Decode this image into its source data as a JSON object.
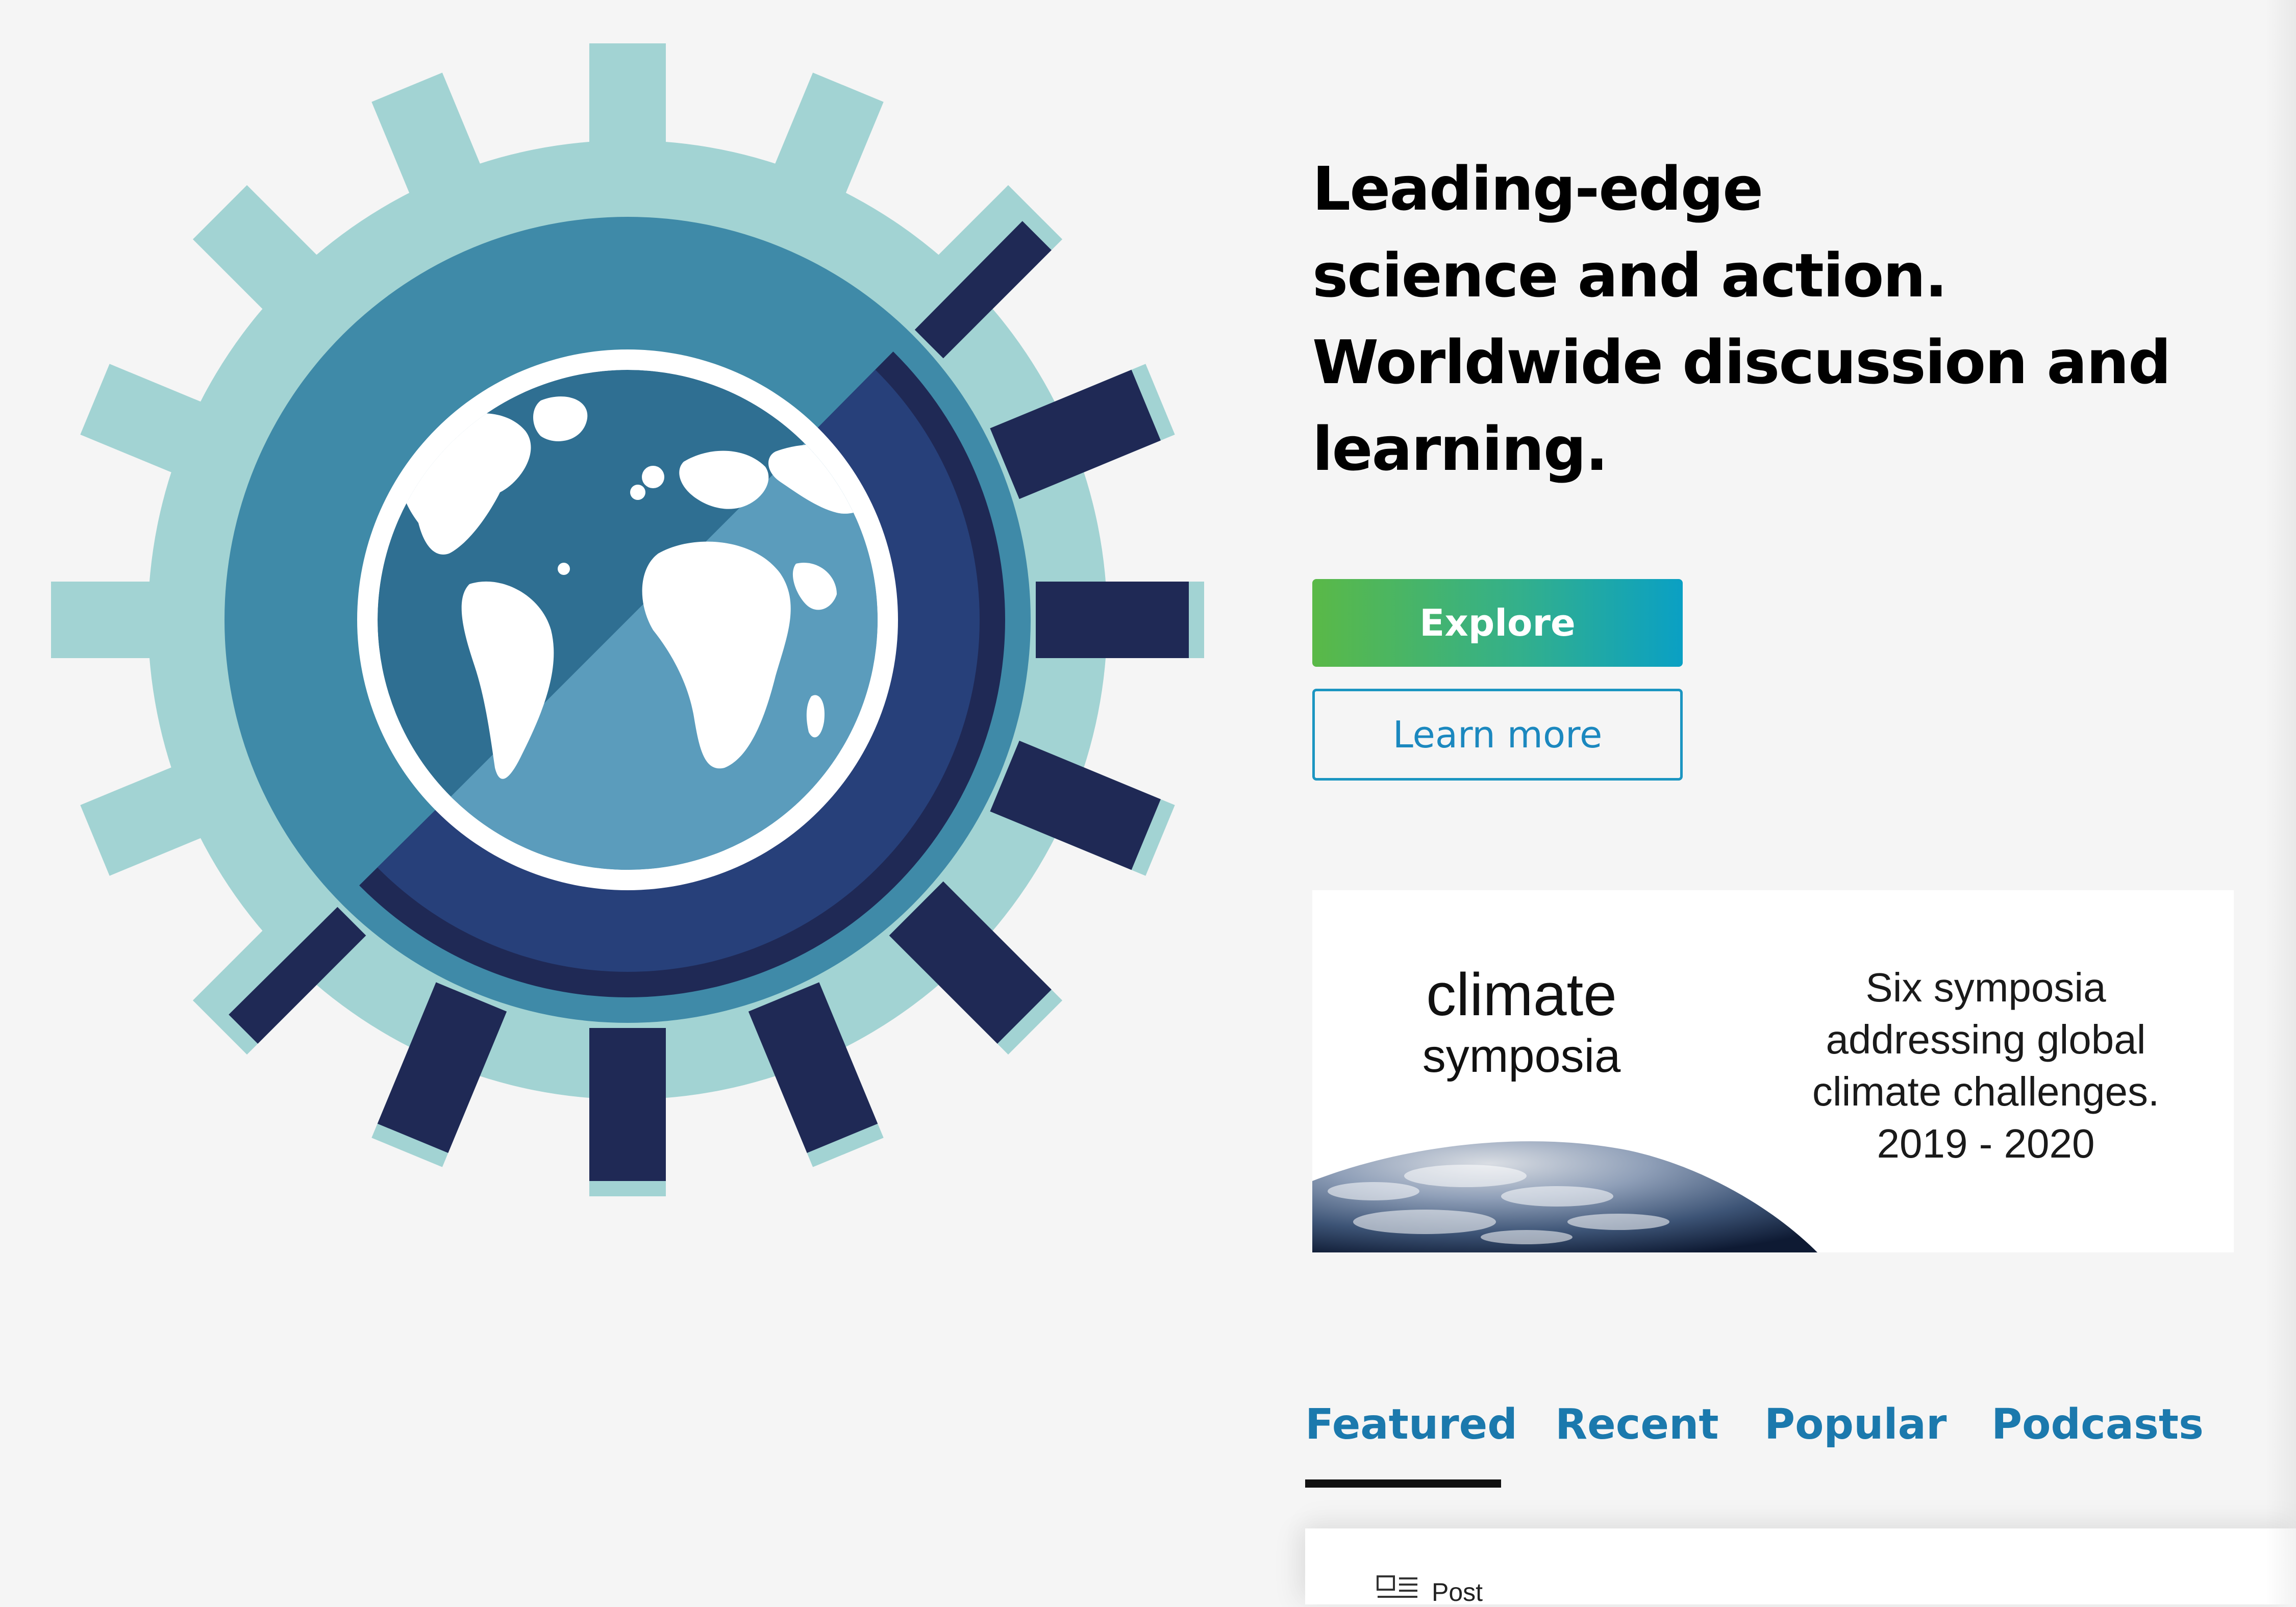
{
  "hero": {
    "headline_lines": [
      "Leading-edge",
      "science and action.",
      "Worldwide discussion and",
      "learning."
    ],
    "explore_label": "Explore",
    "learn_more_label": "Learn more",
    "logo_icon": "gear-globe-logo-icon"
  },
  "banner": {
    "title_line1": "climate",
    "title_line2": "symposia",
    "description_lines": [
      "Six symposia",
      "addressing global",
      "climate challenges.",
      "2019 - 2020"
    ],
    "earth_icon": "earth-from-space-icon"
  },
  "tabs": {
    "items": [
      {
        "label": "Featured",
        "active": true
      },
      {
        "label": "Recent",
        "active": false
      },
      {
        "label": "Popular",
        "active": false
      },
      {
        "label": "Podcasts",
        "active": false
      }
    ]
  },
  "content": {
    "post_type_label": "Post",
    "post_icon": "article-icon"
  },
  "colors": {
    "background": "#f5f5f5",
    "gear_light": "#a2d3d3",
    "gear_mid": "#3f8aa8",
    "gear_dark": "#1f2955",
    "globe_ocean": "#2f6f92",
    "tab_text": "#1b79ad",
    "explore_gradient_start": "#5ab947",
    "explore_gradient_end": "#0aa0c4",
    "learn_more_border": "#1b95c1"
  }
}
